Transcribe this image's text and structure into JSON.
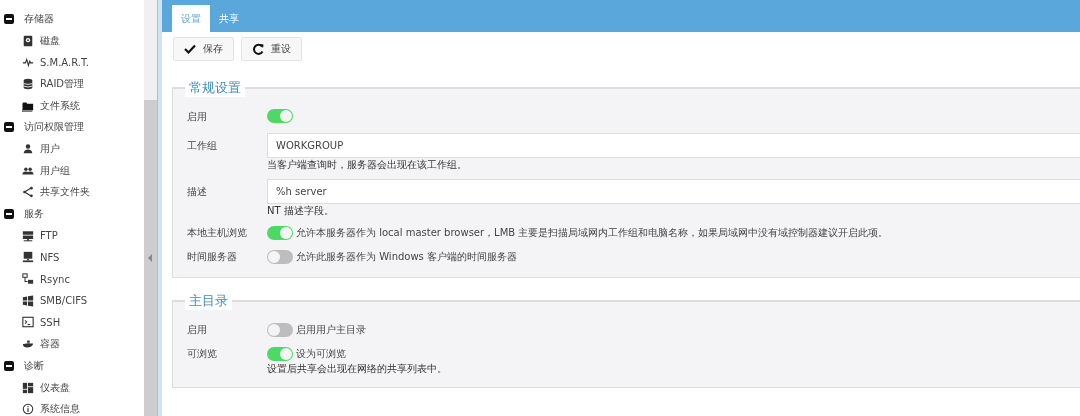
{
  "sidebar": {
    "groups": [
      {
        "label": "存储器",
        "expanded": true,
        "children": [
          {
            "label": "磁盘",
            "kind": "disk"
          },
          {
            "label": "S.M.A.R.T.",
            "kind": "pulse"
          },
          {
            "label": "RAID管理",
            "kind": "database"
          },
          {
            "label": "文件系统",
            "kind": "folder"
          }
        ]
      },
      {
        "label": "访问权限管理",
        "expanded": true,
        "children": [
          {
            "label": "用户",
            "kind": "user"
          },
          {
            "label": "用户组",
            "kind": "users"
          },
          {
            "label": "共享文件夹",
            "kind": "share"
          }
        ]
      },
      {
        "label": "服务",
        "expanded": true,
        "children": [
          {
            "label": "FTP",
            "kind": "server"
          },
          {
            "label": "NFS",
            "kind": "desktop"
          },
          {
            "label": "Rsync",
            "kind": "network"
          },
          {
            "label": "SMB/CIFS",
            "kind": "windows"
          },
          {
            "label": "SSH",
            "kind": "terminal"
          },
          {
            "label": "容器",
            "kind": "whale"
          }
        ]
      },
      {
        "label": "诊断",
        "expanded": true,
        "children": [
          {
            "label": "仪表盘",
            "kind": "dashboard"
          },
          {
            "label": "系统信息",
            "kind": "info"
          }
        ]
      }
    ]
  },
  "tabs": [
    {
      "label": "设置",
      "selected": true
    },
    {
      "label": "共享",
      "selected": false
    }
  ],
  "toolbar": [
    {
      "label": "保存",
      "kind": "check"
    },
    {
      "label": "重设",
      "kind": "refresh"
    }
  ],
  "sections": [
    {
      "title": "常规设置",
      "rows": [
        {
          "kind": "toggle",
          "label": "启用",
          "on": true
        },
        {
          "kind": "text",
          "label": "工作组",
          "value": "WORKGROUP",
          "hint": "当客户端查询时，服务器会出现在该工作组。"
        },
        {
          "kind": "text",
          "label": "描述",
          "value": "%h server",
          "hint": "NT 描述字段。"
        },
        {
          "kind": "toggle",
          "label": "本地主机浏览",
          "on": true,
          "text": "允许本服务器作为 local master browser，LMB 主要是扫描局域网内工作组和电脑名称，如果局域网中没有域控制器建议开启此项。"
        },
        {
          "kind": "toggle",
          "label": "时间服务器",
          "on": false,
          "text": "允许此服务器作为 Windows 客户端的时间服务器"
        }
      ]
    },
    {
      "title": "主目录",
      "rows": [
        {
          "kind": "toggle",
          "label": "启用",
          "on": false,
          "text": "启用用户主目录"
        },
        {
          "kind": "toggle",
          "label": "可浏览",
          "on": true,
          "text": "设为可浏览",
          "hint": "设置后共享会出现在网络的共享列表中。"
        }
      ]
    }
  ]
}
